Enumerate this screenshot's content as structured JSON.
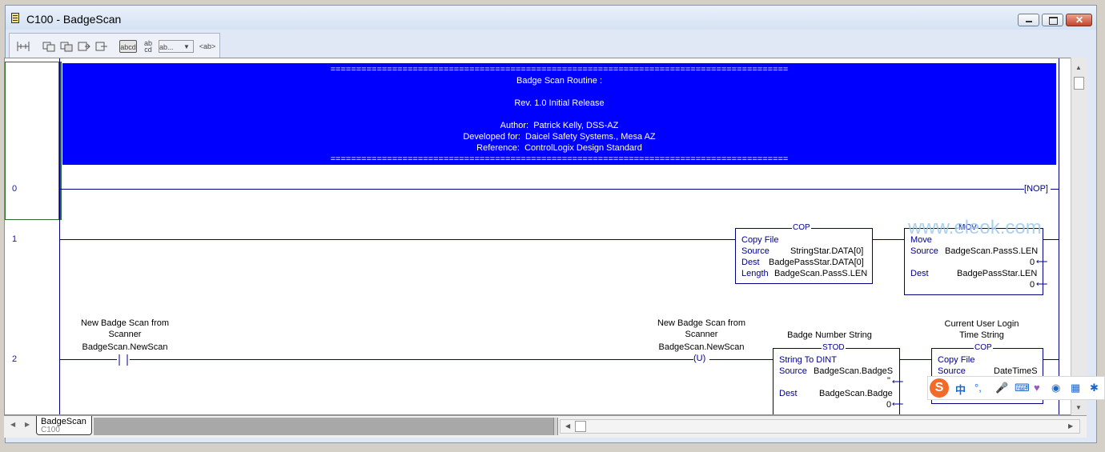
{
  "window": {
    "title": "C100 - BadgeScan"
  },
  "toolbar": {
    "items": [
      "tool-rung",
      "tool-branch-a",
      "tool-branch-b",
      "tool-insert",
      "tool-append",
      "abcd",
      "ab cd",
      "ab...",
      "<ab>"
    ]
  },
  "comment": {
    "sep": "=========================================================================================",
    "line1": "Badge Scan Routine :",
    "line2": "Rev. 1.0 Initial Release",
    "line3": "Author:  Patrick Kelly, DSS-AZ",
    "line4": "Developed for:  Daicel Safety Systems., Mesa AZ",
    "line5": "Reference:  ControlLogix Design Standard"
  },
  "rungs": {
    "r0": {
      "num": "0",
      "nop": "NOP"
    },
    "r1": {
      "num": "1",
      "cop": {
        "name": "COP",
        "title": "Copy File",
        "source_label": "Source",
        "source": "StringStar.DATA[0]",
        "dest_label": "Dest",
        "dest": "BadgePassStar.DATA[0]",
        "length_label": "Length",
        "length": "BadgeScan.PassS.LEN"
      },
      "mov": {
        "name": "MOV",
        "title": "Move",
        "source_label": "Source",
        "source": "BadgeScan.PassS.LEN",
        "source_val": "0",
        "dest_label": "Dest",
        "dest": "BadgePassStar.LEN",
        "dest_val": "0"
      }
    },
    "r2": {
      "num": "2",
      "contact": {
        "desc1": "New Badge Scan from",
        "desc2": "Scanner",
        "tag": "BadgeScan.NewScan"
      },
      "coil": {
        "desc1": "New Badge Scan from",
        "desc2": "Scanner",
        "tag": "BadgeScan.NewScan",
        "symbol": "U"
      },
      "stod": {
        "desc": "Badge Number String",
        "name": "STOD",
        "title": "String To DINT",
        "source_label": "Source",
        "source": "BadgeScan.BadgeS",
        "source_val": "\"",
        "dest_label": "Dest",
        "dest": "BadgeScan.Badge",
        "dest_val": "0"
      },
      "cop2": {
        "desc1": "Current User Login",
        "desc2": "Time String",
        "name": "COP",
        "title": "Copy File",
        "source_label": "Source",
        "source": "DateTimeS"
      }
    }
  },
  "tabs": {
    "active_label": "BadgeScan",
    "sub_label": "C100"
  },
  "watermark": "www.eleok.com",
  "ime": {
    "chinese": "中"
  }
}
